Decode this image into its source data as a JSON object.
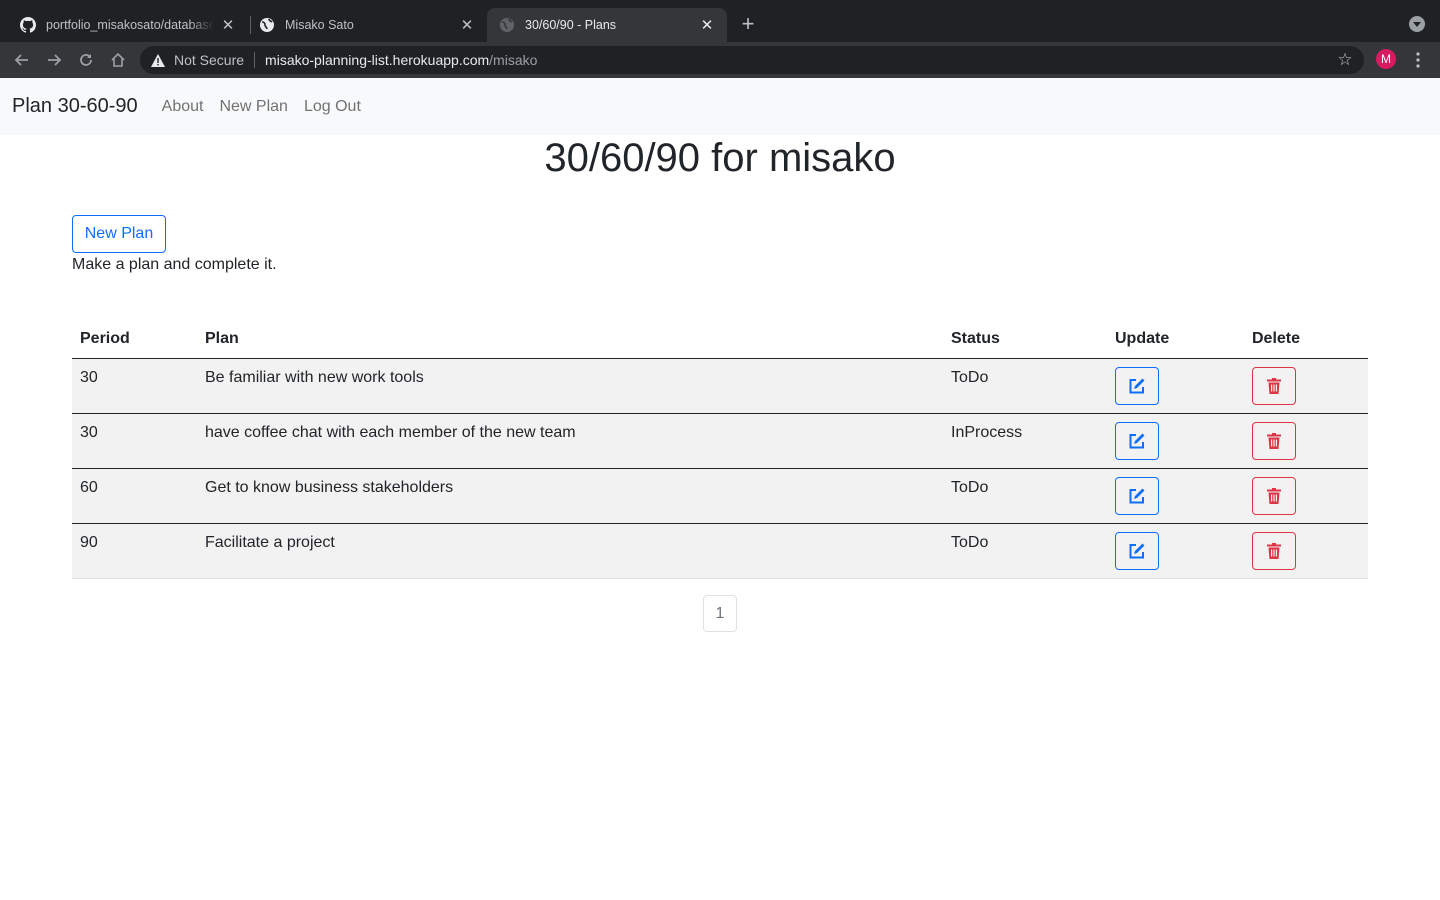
{
  "browser": {
    "tabs": [
      {
        "title": "portfolio_misakosato/database",
        "icon": "github-icon",
        "active": false
      },
      {
        "title": "Misako Sato",
        "icon": "globe-icon",
        "active": false
      },
      {
        "title": "30/60/90 - Plans",
        "icon": "globe-icon",
        "active": true
      }
    ],
    "security_label": "Not Secure",
    "url_host": "misako-planning-list.herokuapp.com",
    "url_path": "/misako",
    "profile_initial": "M"
  },
  "navbar": {
    "brand": "Plan 30-60-90",
    "links": [
      "About",
      "New Plan",
      "Log Out"
    ]
  },
  "page": {
    "title": "30/60/90 for misako",
    "new_plan_button": "New Plan",
    "hint": "Make a plan and complete it."
  },
  "table": {
    "headers": [
      "Period",
      "Plan",
      "Status",
      "Update",
      "Delete"
    ],
    "rows": [
      {
        "period": "30",
        "plan": "Be familiar with new work tools",
        "status": "ToDo"
      },
      {
        "period": "30",
        "plan": "have coffee chat with each member of the new team",
        "status": "InProcess"
      },
      {
        "period": "60",
        "plan": "Get to know business stakeholders",
        "status": "ToDo"
      },
      {
        "period": "90",
        "plan": "Facilitate a project",
        "status": "ToDo"
      }
    ]
  },
  "pagination": {
    "current": "1"
  },
  "colors": {
    "primary": "#0d6efd",
    "danger": "#dc3545",
    "navbar_bg": "#f8f9fa",
    "row_bg": "#f2f2f2"
  }
}
